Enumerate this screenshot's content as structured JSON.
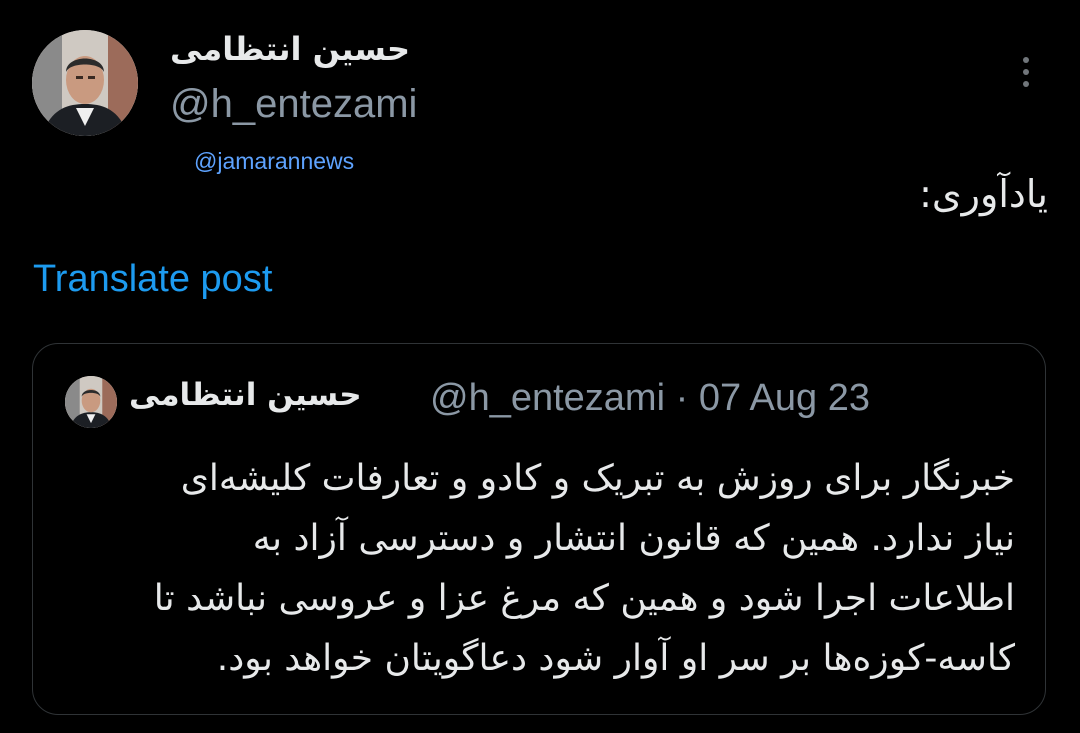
{
  "author": {
    "display_name": "حسین انتظامی",
    "handle": "@h_entezami",
    "avatar_icon": "profile-photo"
  },
  "watermark": "@jamarannews",
  "post": {
    "text": "یادآوری:",
    "translate_label": "Translate post"
  },
  "quoted_post": {
    "display_name": "حسین انتظامی",
    "handle": "@h_entezami",
    "separator": "·",
    "date": "07 Aug 23",
    "lines": [
      "خبرنگار برای روزش به تبریک و کادو و تعارفات کلیشه‌ای",
      "نیاز ندارد. همین که قانون انتشار و دسترسی آزاد به",
      "اطلاعات اجرا شود و همین که مرغ عزا و عروسی نباشد تا",
      "کاسه-کوزه‌ها بر سر او آوار شود دعاگویتان خواهد بود."
    ]
  },
  "colors": {
    "background": "#000000",
    "text": "#e7e9ea",
    "muted": "#8b98a5",
    "link": "#1d9bf0",
    "border": "#2f3336",
    "watermark": "#5ea3ff"
  }
}
